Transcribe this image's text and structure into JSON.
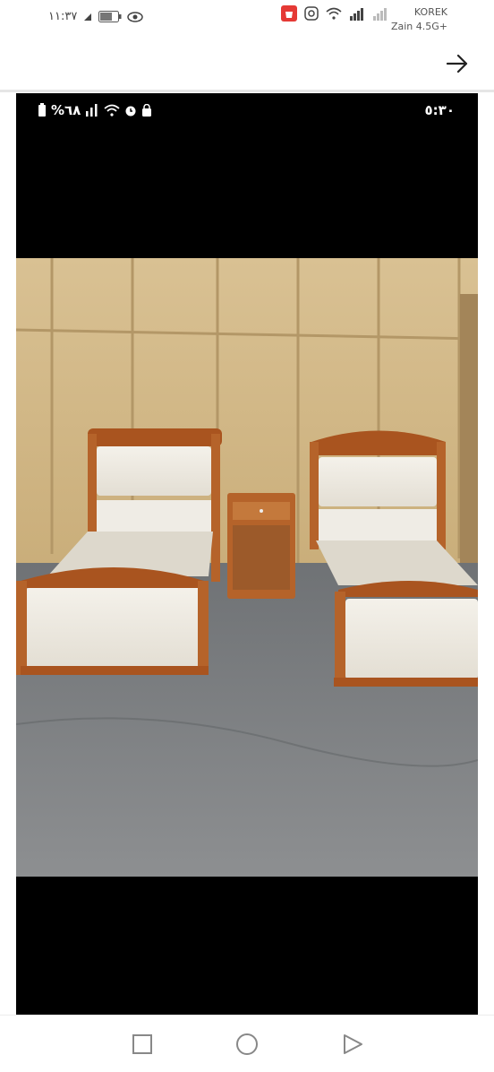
{
  "status_bar": {
    "time": "١١:٣٧",
    "carrier_name": "KOREK",
    "carrier_network": "Zain 4.5G+",
    "icons": [
      "dnd-icon",
      "battery-icon",
      "eye-icon",
      "shopping-app-icon",
      "instagram-icon",
      "wifi-icon",
      "signal-icon",
      "no-signal-icon"
    ]
  },
  "toolbar": {
    "back_icon": "arrow-right-icon"
  },
  "screenshot": {
    "status": {
      "battery": "%٦٨",
      "time": "٥:٣٠"
    },
    "photo_description_icon": "beds-photo"
  },
  "nav": {
    "icons": [
      "recents-square-icon",
      "home-circle-icon",
      "back-triangle-icon"
    ]
  },
  "colors": {
    "accent": "#e53935",
    "wood": "#b5632a",
    "wall": "#d7bd8b",
    "floor": "#7d7f82"
  }
}
